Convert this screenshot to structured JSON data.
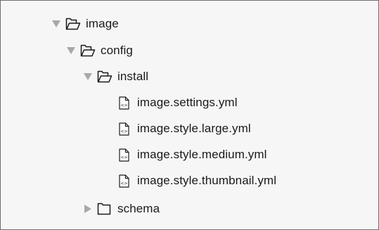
{
  "tree": {
    "root": {
      "label": "image",
      "expanded": true
    },
    "config": {
      "label": "config",
      "expanded": true
    },
    "install": {
      "label": "install",
      "expanded": true
    },
    "files": [
      {
        "label": "image.settings.yml",
        "icon": "yml-file-icon"
      },
      {
        "label": "image.style.large.yml",
        "icon": "yml-file-icon"
      },
      {
        "label": "image.style.medium.yml",
        "icon": "yml-file-icon"
      },
      {
        "label": "image.style.thumbnail.yml",
        "icon": "yml-file-icon"
      }
    ],
    "schema": {
      "label": "schema",
      "expanded": false
    }
  },
  "colors": {
    "disclosure": "#a8a8a8",
    "text": "#1a1a1a",
    "background": "#f6f6f6",
    "border": "#6e6e6e"
  }
}
